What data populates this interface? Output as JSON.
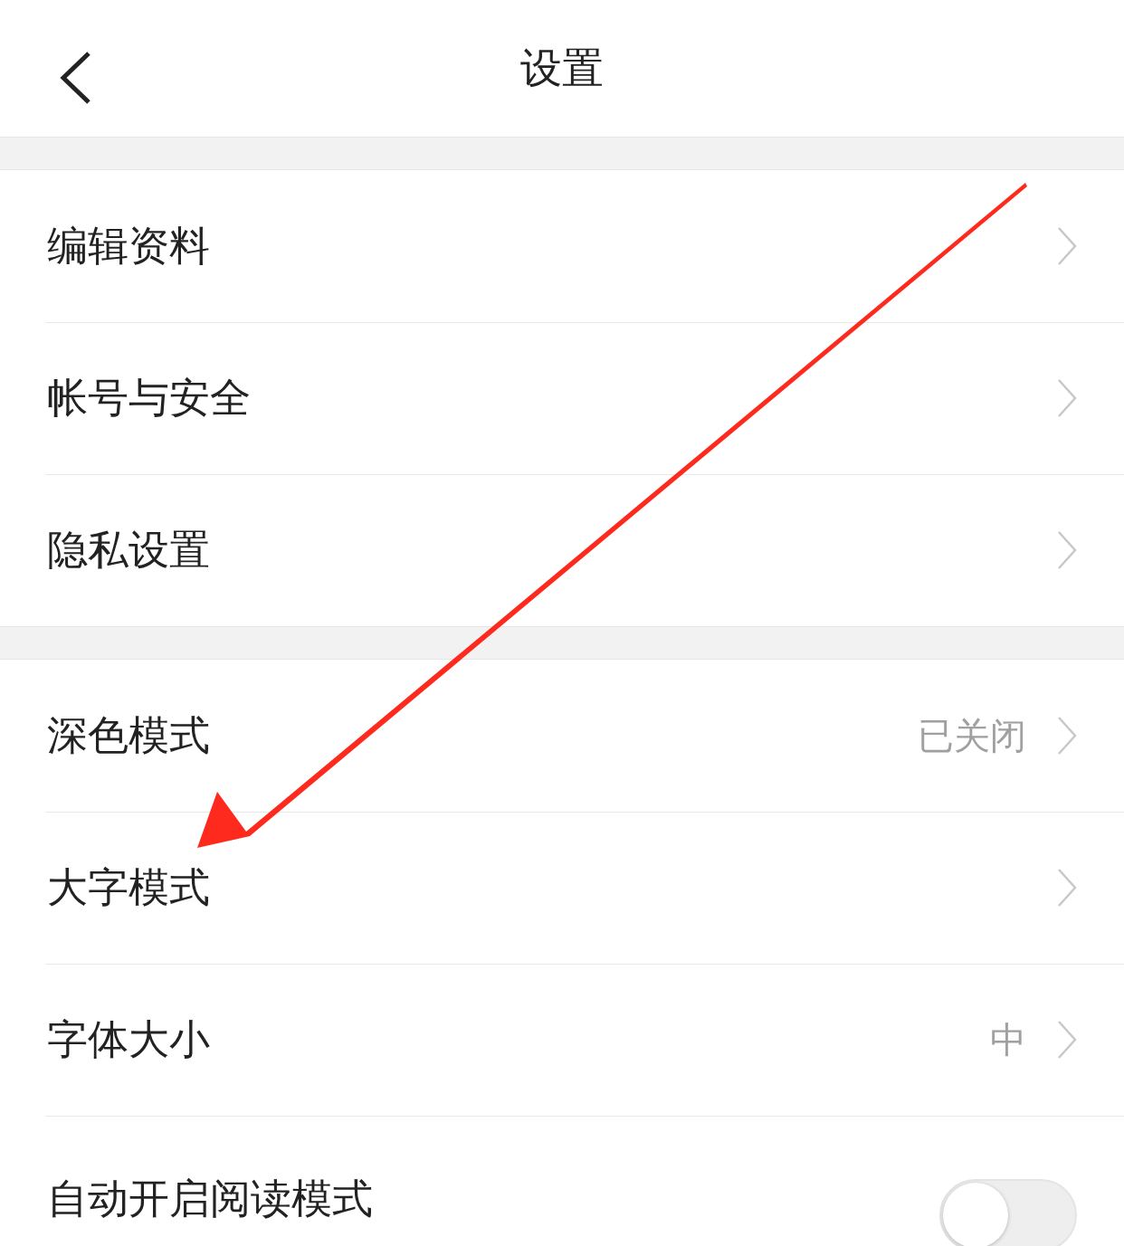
{
  "header": {
    "title": "设置"
  },
  "groups": [
    {
      "items": [
        {
          "kind": "link",
          "label": "编辑资料"
        },
        {
          "kind": "link",
          "label": "帐号与安全"
        },
        {
          "kind": "link",
          "label": "隐私设置"
        }
      ]
    },
    {
      "items": [
        {
          "kind": "link",
          "label": "深色模式",
          "value": "已关闭"
        },
        {
          "kind": "link",
          "label": "大字模式"
        },
        {
          "kind": "link",
          "label": "字体大小",
          "value": "中"
        },
        {
          "kind": "switch",
          "label": "自动开启阅读模式",
          "on": false
        }
      ]
    }
  ]
}
